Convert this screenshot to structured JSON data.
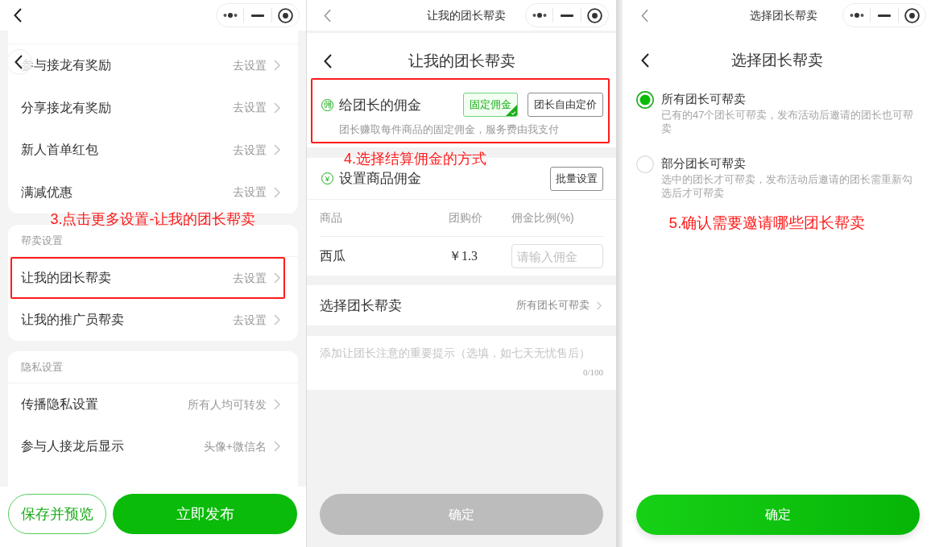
{
  "settings_screen": {
    "reward_group": {
      "rows": [
        {
          "label": "参与接龙有奖励",
          "value": "去设置",
          "highlighted": false
        },
        {
          "label": "分享接龙有奖励",
          "value": "去设置",
          "highlighted": false
        },
        {
          "label": "新人首单红包",
          "value": "去设置",
          "highlighted": false
        },
        {
          "label": "满减优惠",
          "value": "去设置",
          "highlighted": false
        }
      ]
    },
    "annotation": "3.点击更多设置-让我的团长帮卖",
    "help_sell_group": {
      "header": "帮卖设置",
      "rows": [
        {
          "label": "让我的团长帮卖",
          "value": "去设置",
          "highlighted": true
        },
        {
          "label": "让我的推广员帮卖",
          "value": "去设置",
          "highlighted": false
        }
      ]
    },
    "privacy_group": {
      "header": "隐私设置",
      "rows": [
        {
          "label": "传播隐私设置",
          "value": "所有人均可转发",
          "highlighted": false
        },
        {
          "label": "参与人接龙后显示",
          "value": "头像+微信名",
          "highlighted": false
        }
      ]
    },
    "buttons": [
      {
        "label": "保存并预览",
        "kind": "outline"
      },
      {
        "label": "立即发布",
        "kind": "filled"
      }
    ]
  },
  "commission_screen": {
    "window_title": "让我的团长帮卖",
    "page_title": "让我的团长帮卖",
    "commission_mode": {
      "symbol": "佣",
      "label": "给团长的佣金",
      "highlighted": true,
      "options": [
        {
          "label": "固定佣金",
          "selected": true
        },
        {
          "label": "团长自由定价",
          "selected": false
        }
      ],
      "description": "团长赚取每件商品的固定佣金，服务费由我支付"
    },
    "annotation": "4.选择结算佣金的方式",
    "product_commission": {
      "symbol": "¥",
      "label": "设置商品佣金",
      "batch_button": "批量设置",
      "table": {
        "columns": [
          "商品",
          "团购价",
          "佣金比例(%)"
        ],
        "rows": [
          {
            "product": "西瓜",
            "price": "￥1.3",
            "commission": {
              "placeholder": "请输入佣金"
            }
          }
        ]
      }
    },
    "leader_picker": {
      "label": "选择团长帮卖",
      "value": "所有团长可帮卖"
    },
    "note": {
      "placeholder": "添加让团长注意的重要提示（选填，如七天无忧售后）",
      "counter": "0/100"
    },
    "confirm_button": {
      "label": "确定",
      "disabled": true
    }
  },
  "select_screen": {
    "window_title": "选择团长帮卖",
    "page_title": "选择团长帮卖",
    "options": [
      {
        "title": "所有团长可帮卖",
        "description": "已有的47个团长可帮卖，发布活动后邀请的团长也可帮卖",
        "selected": true
      },
      {
        "title": "部分团长可帮卖",
        "description": "选中的团长才可帮卖，发布活动后邀请的团长需重新勾选后才可帮卖",
        "selected": false
      }
    ],
    "annotation": "5.确认需要邀请哪些团长帮卖",
    "confirm_button": {
      "label": "确定",
      "disabled": false
    }
  }
}
